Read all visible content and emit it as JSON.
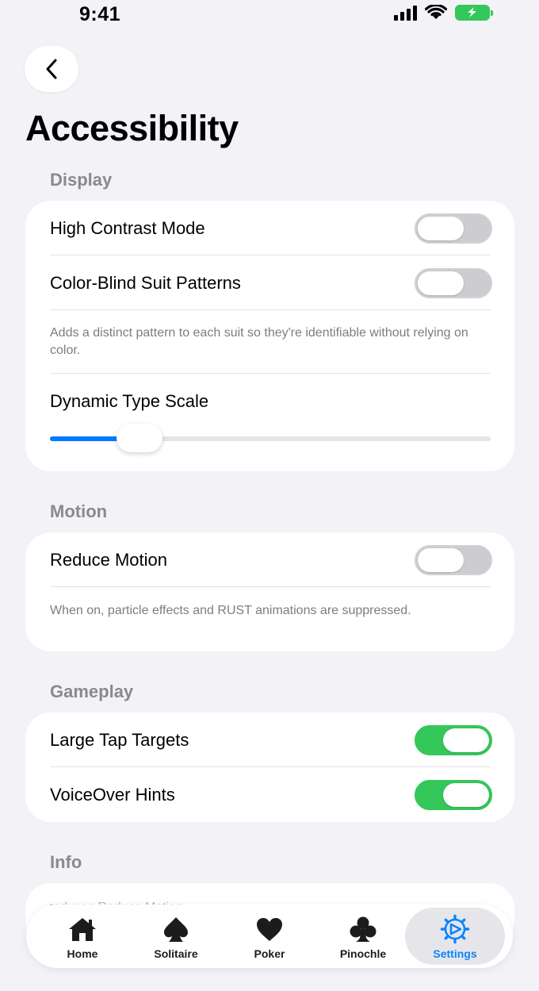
{
  "status_bar": {
    "time": "9:41"
  },
  "page": {
    "title": "Accessibility"
  },
  "sections": {
    "display": {
      "header": "Display",
      "high_contrast_label": "High Contrast Mode",
      "color_blind_label": "Color-Blind Suit Patterns",
      "color_blind_footnote": "Adds a distinct pattern to each suit so they're identifiable without relying on color.",
      "dynamic_type_label": "Dynamic Type Scale",
      "dynamic_type_value": 0.2
    },
    "motion": {
      "header": "Motion",
      "reduce_motion_label": "Reduce Motion",
      "reduce_motion_footnote": "When on, particle effects and RUST animations are suppressed."
    },
    "gameplay": {
      "header": "Gameplay",
      "large_tap_label": "Large Tap Targets",
      "voiceover_label": "VoiceOver Hints"
    },
    "info": {
      "header": "Info",
      "peek_text": "reduces Reduce Motion."
    }
  },
  "toggles": {
    "high_contrast": false,
    "color_blind": false,
    "reduce_motion": false,
    "large_tap": true,
    "voiceover": true
  },
  "tab_bar": {
    "items": [
      {
        "label": "Home",
        "icon": "house-icon"
      },
      {
        "label": "Solitaire",
        "icon": "spade-icon"
      },
      {
        "label": "Poker",
        "icon": "heart-icon"
      },
      {
        "label": "Pinochle",
        "icon": "club-icon"
      },
      {
        "label": "Settings",
        "icon": "gear-icon"
      }
    ],
    "active_index": 4
  },
  "colors": {
    "accent": "#007aff",
    "toggle_on": "#34c759",
    "toggle_off": "#cdcdd1",
    "background": "#f2f2f7"
  }
}
